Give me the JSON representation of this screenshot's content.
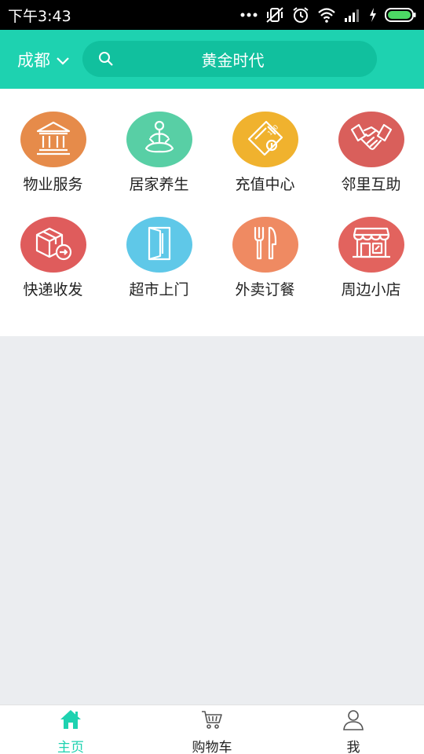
{
  "status_bar": {
    "time": "下午3:43"
  },
  "header": {
    "city": "成都",
    "search_text": "黄金时代"
  },
  "services": [
    {
      "label": "物业服务",
      "icon": "bank-icon",
      "color": "#e68b4a"
    },
    {
      "label": "居家养生",
      "icon": "meditation-icon",
      "color": "#58cfa5"
    },
    {
      "label": "充值中心",
      "icon": "recharge-card-icon",
      "color": "#f0b22e"
    },
    {
      "label": "邻里互助",
      "icon": "handshake-icon",
      "color": "#d95f5b"
    },
    {
      "label": "快递收发",
      "icon": "parcel-icon",
      "color": "#df5c5c"
    },
    {
      "label": "超市上门",
      "icon": "door-icon",
      "color": "#5fc8e8"
    },
    {
      "label": "外卖订餐",
      "icon": "cutlery-icon",
      "color": "#ef8a62"
    },
    {
      "label": "周边小店",
      "icon": "shop-icon",
      "color": "#e2635e"
    }
  ],
  "tabs": [
    {
      "label": "主页",
      "icon": "home-icon",
      "active": true
    },
    {
      "label": "购物车",
      "icon": "cart-icon",
      "active": false
    },
    {
      "label": "我",
      "icon": "user-icon",
      "active": false
    }
  ],
  "colors": {
    "accent": "#1ed2b0",
    "search_bg": "#11c09e",
    "background": "#ebedf0"
  }
}
